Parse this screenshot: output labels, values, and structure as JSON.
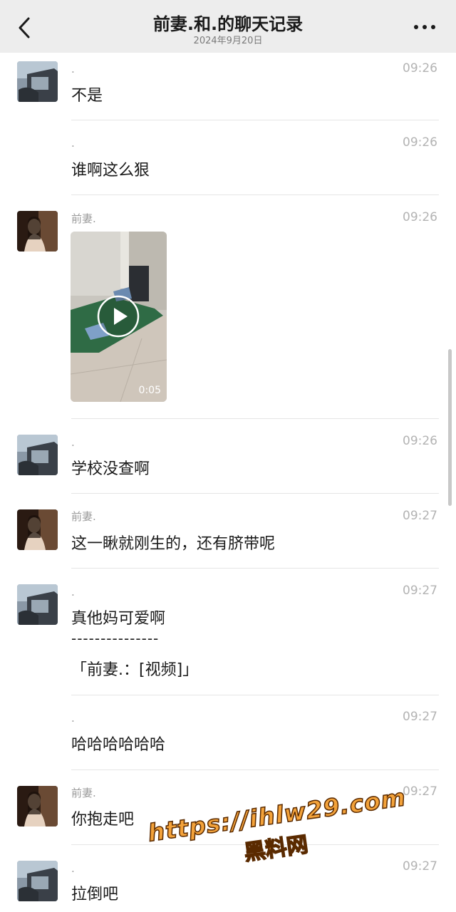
{
  "header": {
    "title": "前妻.和.的聊天记录",
    "subtitle": "2024年9月20日",
    "back_icon": "chevron-left-icon",
    "more_icon": "more-dots-icon"
  },
  "messages": [
    {
      "sender": ".",
      "time": "09:26",
      "lines": [
        "不是"
      ]
    },
    {
      "sender": ".",
      "time": "09:26",
      "lines": [
        "谁啊这么狠"
      ]
    },
    {
      "sender": "前妻.",
      "time": "09:26",
      "video": {
        "duration": "0:05"
      }
    },
    {
      "sender": ".",
      "time": "09:26",
      "lines": [
        "学校没查啊"
      ]
    },
    {
      "sender": "前妻.",
      "time": "09:27",
      "lines": [
        "这一瞅就刚生的，还有脐带呢"
      ]
    },
    {
      "sender": ".",
      "time": "09:27",
      "lines": [
        "真他妈可爱啊",
        "---------------",
        "「前妻.：[视频]」"
      ]
    },
    {
      "sender": ".",
      "time": "09:27",
      "lines": [
        "哈哈哈哈哈哈"
      ]
    },
    {
      "sender": "前妻.",
      "time": "09:27",
      "lines": [
        "你抱走吧"
      ]
    },
    {
      "sender": ".",
      "time": "09:27",
      "lines": [
        "拉倒吧"
      ]
    }
  ],
  "watermark": {
    "url": "https://ihlw29.com",
    "name": "黑料网"
  }
}
